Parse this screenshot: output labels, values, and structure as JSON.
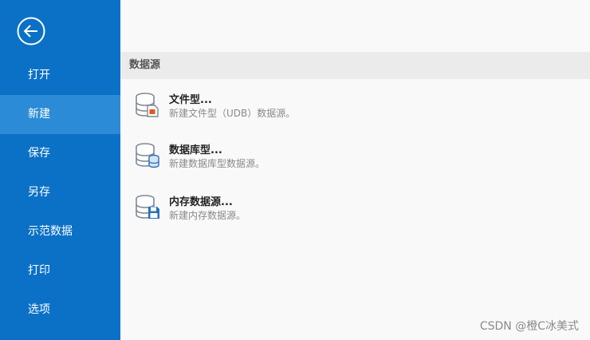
{
  "sidebar": {
    "back_icon": "arrow-left-circle-icon",
    "items": [
      {
        "label": "打开",
        "active": false
      },
      {
        "label": "新建",
        "active": true
      },
      {
        "label": "保存",
        "active": false
      },
      {
        "label": "另存",
        "active": false
      },
      {
        "label": "示范数据",
        "active": false
      },
      {
        "label": "打印",
        "active": false
      },
      {
        "label": "选项",
        "active": false
      }
    ]
  },
  "main": {
    "section_title": "数据源",
    "options": [
      {
        "title": "文件型...",
        "description": "新建文件型（UDB）数据源。",
        "icon": "file-database-icon"
      },
      {
        "title": "数据库型...",
        "description": "新建数据库型数据源。",
        "icon": "database-icon"
      },
      {
        "title": "内存数据源...",
        "description": "新建内存数据源。",
        "icon": "memory-database-icon"
      }
    ]
  },
  "watermark": "CSDN @橙C冰美式",
  "colors": {
    "sidebar_bg": "#0b71c6",
    "sidebar_active": "#2b8bd6",
    "content_bg": "#f9f9f9",
    "section_header_bg": "#ebebeb",
    "icon_gray": "#7f8a96",
    "icon_accent_orange": "#e05a1a",
    "icon_accent_blue": "#2a6fba"
  }
}
